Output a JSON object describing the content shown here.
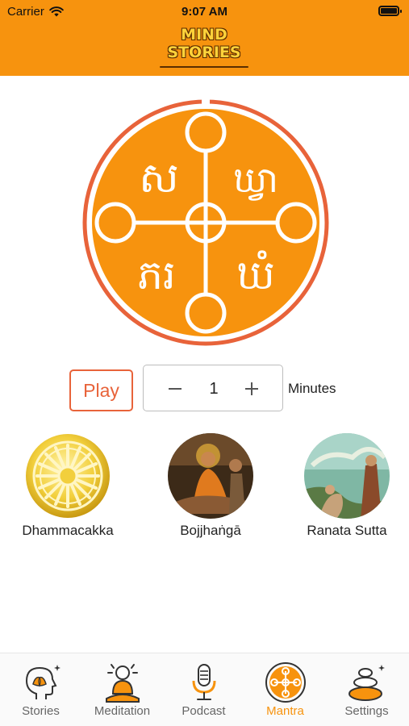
{
  "status_bar": {
    "carrier": "Carrier",
    "time": "9:07 AM"
  },
  "header": {
    "logo_line1": "MIND",
    "logo_line2": "STORIES",
    "background": "#f7930e"
  },
  "mantra_art": {
    "symbol_top_left": "ស",
    "symbol_top_right": "ឃ្វា",
    "symbol_bottom_left": "ភរ",
    "symbol_bottom_right": "ឃំ",
    "ring_color": "#e8633a",
    "fill_color": "#f7930e"
  },
  "controls": {
    "play_label": "Play",
    "minutes_value": "1",
    "minutes_label": "Minutes",
    "accent": "#e8633a"
  },
  "mantras": [
    {
      "label": "Dhammacakka",
      "icon": "dhamma-wheel-icon"
    },
    {
      "label": "Bojjhaṅgā",
      "icon": "buddha-painting"
    },
    {
      "label": "Ranata Sutta",
      "icon": "ratana-painting"
    }
  ],
  "tabs": [
    {
      "label": "Stories",
      "icon": "head-lotus-icon",
      "active": false
    },
    {
      "label": "Meditation",
      "icon": "meditating-monk-icon",
      "active": false
    },
    {
      "label": "Podcast",
      "icon": "microphone-icon",
      "active": false
    },
    {
      "label": "Mantra",
      "icon": "mantra-circle-icon",
      "active": true
    },
    {
      "label": "Settings",
      "icon": "stones-icon",
      "active": false
    }
  ]
}
